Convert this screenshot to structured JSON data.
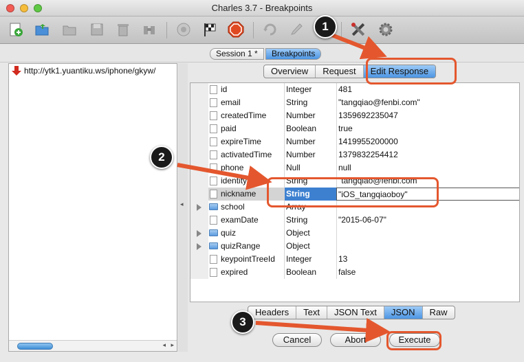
{
  "window": {
    "title": "Charles 3.7 - Breakpoints"
  },
  "session_tabs": [
    {
      "label": "Session 1 *",
      "active": false
    },
    {
      "label": "Breakpoints",
      "active": true
    }
  ],
  "left_pane": {
    "url": "http://ytk1.yuantiku.ws/iphone/gkyw/"
  },
  "view_tabs": [
    {
      "label": "Overview",
      "active": false
    },
    {
      "label": "Request",
      "active": false
    },
    {
      "label": "Edit Response",
      "active": true
    }
  ],
  "table": {
    "rows": [
      {
        "name": "id",
        "type": "Integer",
        "value": "481",
        "kind": "leaf"
      },
      {
        "name": "email",
        "type": "String",
        "value": "\"tangqiao@fenbi.com\"",
        "kind": "leaf"
      },
      {
        "name": "createdTime",
        "type": "Number",
        "value": "1359692235047",
        "kind": "leaf"
      },
      {
        "name": "paid",
        "type": "Boolean",
        "value": "true",
        "kind": "leaf"
      },
      {
        "name": "expireTime",
        "type": "Number",
        "value": "1419955200000",
        "kind": "leaf"
      },
      {
        "name": "activatedTime",
        "type": "Number",
        "value": "1379832254412",
        "kind": "leaf"
      },
      {
        "name": "phone",
        "type": "Null",
        "value": "null",
        "kind": "leaf"
      },
      {
        "name": "identity",
        "type": "String",
        "value": "\"tangqiao@fenbi.com",
        "kind": "leaf"
      },
      {
        "name": "nickname",
        "type": "String",
        "value": "\"iOS_tangqiaoboy\"",
        "kind": "leaf",
        "selected": true
      },
      {
        "name": "school",
        "type": "Array",
        "value": "",
        "kind": "folder"
      },
      {
        "name": "examDate",
        "type": "String",
        "value": "\"2015-06-07\"",
        "kind": "leaf"
      },
      {
        "name": "quiz",
        "type": "Object",
        "value": "",
        "kind": "folder"
      },
      {
        "name": "quizRange",
        "type": "Object",
        "value": "",
        "kind": "folder"
      },
      {
        "name": "keypointTreeId",
        "type": "Integer",
        "value": "13",
        "kind": "leaf"
      },
      {
        "name": "expired",
        "type": "Boolean",
        "value": "false",
        "kind": "leaf"
      }
    ]
  },
  "format_tabs": [
    {
      "label": "Headers",
      "active": false
    },
    {
      "label": "Text",
      "active": false
    },
    {
      "label": "JSON Text",
      "active": false
    },
    {
      "label": "JSON",
      "active": true
    },
    {
      "label": "Raw",
      "active": false
    }
  ],
  "buttons": {
    "cancel": "Cancel",
    "abort": "Abort",
    "execute": "Execute"
  },
  "annotations": {
    "step1": "1",
    "step2": "2",
    "step3": "3"
  },
  "colors": {
    "selection": "#3d80d0",
    "accent": "#e4572e"
  }
}
